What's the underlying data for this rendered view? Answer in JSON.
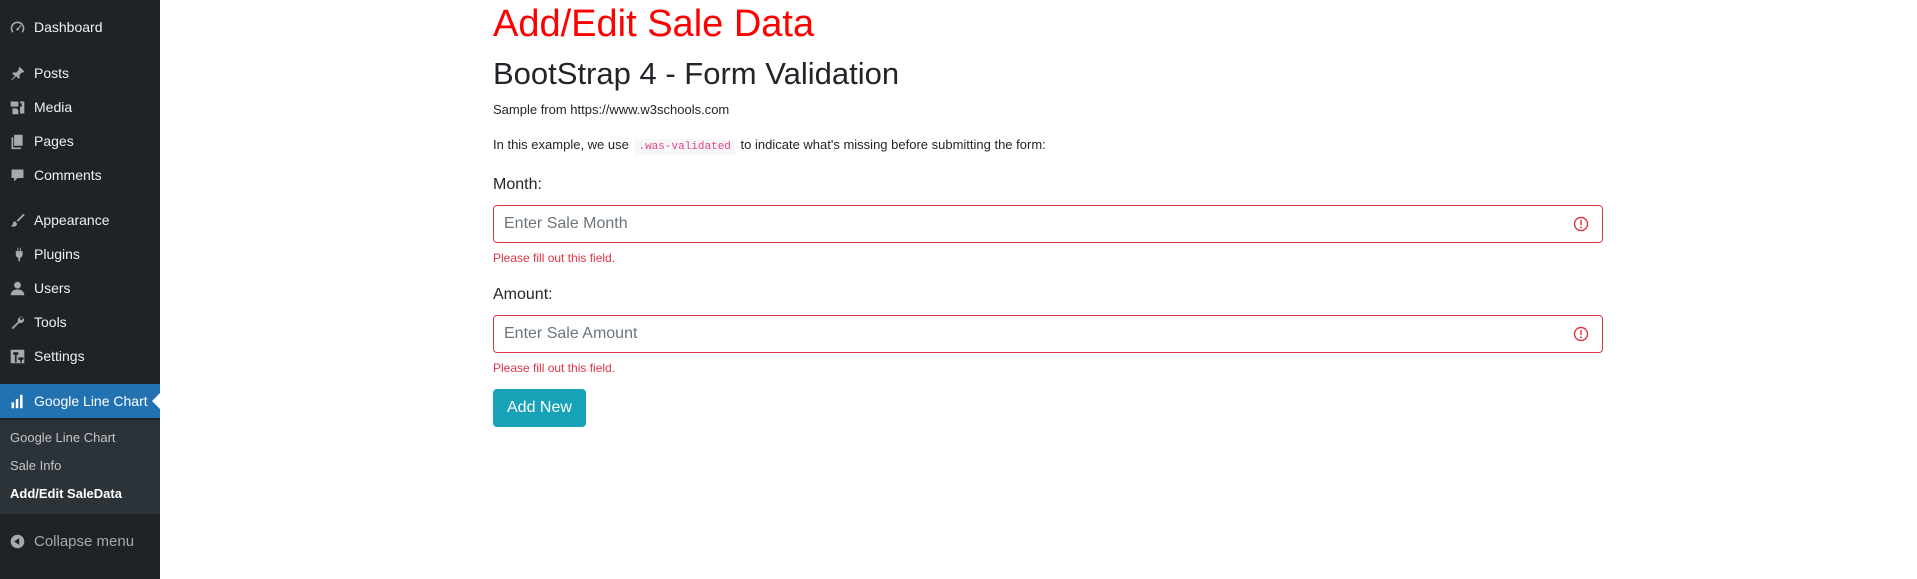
{
  "sidebar": {
    "items": [
      {
        "label": "Dashboard",
        "icon": "dashboard-icon"
      },
      {
        "label": "Posts",
        "icon": "pin-icon"
      },
      {
        "label": "Media",
        "icon": "media-icon"
      },
      {
        "label": "Pages",
        "icon": "pages-icon"
      },
      {
        "label": "Comments",
        "icon": "comment-icon"
      },
      {
        "label": "Appearance",
        "icon": "brush-icon"
      },
      {
        "label": "Plugins",
        "icon": "plug-icon"
      },
      {
        "label": "Users",
        "icon": "user-icon"
      },
      {
        "label": "Tools",
        "icon": "wrench-icon"
      },
      {
        "label": "Settings",
        "icon": "settings-icon"
      },
      {
        "label": "Google Line Chart",
        "icon": "chart-bar-icon",
        "current": true
      }
    ],
    "submenu": [
      "Google Line Chart",
      "Sale Info",
      "Add/Edit SaleData"
    ],
    "collapse_label": "Collapse menu"
  },
  "main": {
    "title": "Add/Edit Sale Data",
    "subtitle": "BootStrap 4 - Form Validation",
    "sample_text": "Sample from https://www.w3schools.com",
    "desc_before": "In this example, we use",
    "desc_code": ".was-validated",
    "desc_after": "to indicate what's missing before submitting the form:",
    "month": {
      "label": "Month:",
      "placeholder": "Enter Sale Month",
      "value": "",
      "error": "Please fill out this field."
    },
    "amount": {
      "label": "Amount:",
      "placeholder": "Enter Sale Amount",
      "value": "",
      "error": "Please fill out this field."
    },
    "submit_label": "Add New"
  },
  "colors": {
    "sidebar_bg": "#1d2327",
    "sidebar_current": "#2271b1",
    "title_red": "#ff0000",
    "error_red": "#dc3545",
    "button_info": "#17a2b8"
  }
}
